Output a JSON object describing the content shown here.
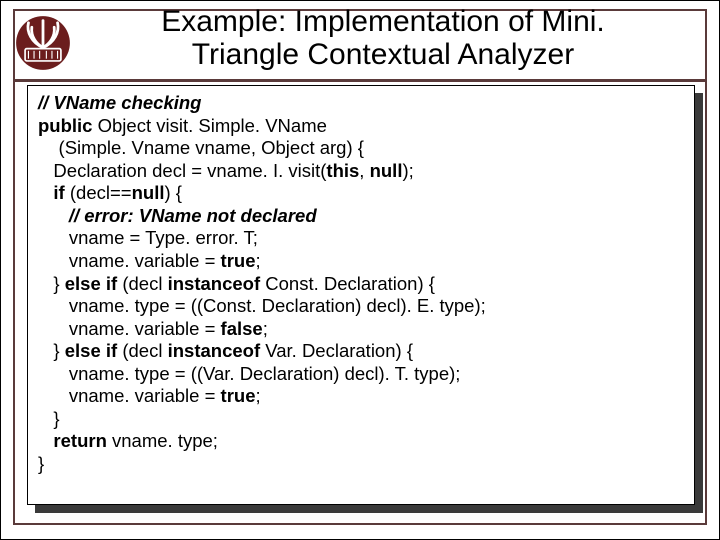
{
  "title_line1": "Example: Implementation of Mini.",
  "title_line2": "Triangle Contextual Analyzer",
  "code": {
    "c00a": "// VName checking",
    "c01a": "public",
    "c01b": " Object visit. Simple. VName",
    "c02a": "    (Simple. Vname vname, Object arg) {",
    "c03a": "   Declaration decl = vname. I. visit(",
    "c03b": "this",
    "c03c": ", ",
    "c03d": "null",
    "c03e": ");",
    "c04a": "   ",
    "c04b": "if",
    "c04c": " (decl==",
    "c04d": "null",
    "c04e": ") {",
    "c05a": "      ",
    "c05b": "// error: VName not declared",
    "c06a": "      vname = Type. error. T;",
    "c07a": "      vname. variable = ",
    "c07b": "true",
    "c07c": ";",
    "c08a": "   } ",
    "c08b": "else if",
    "c08c": " (decl ",
    "c08d": "instanceof",
    "c08e": " Const. Declaration) {",
    "c09a": "      vname. type = ((Const. Declaration) decl). E. type);",
    "c10a": "      vname. variable = ",
    "c10b": "false",
    "c10c": ";",
    "c11a": "   } ",
    "c11b": "else if",
    "c11c": " (decl ",
    "c11d": "instanceof",
    "c11e": " Var. Declaration) {",
    "c12a": "      vname. type = ((Var. Declaration) decl). T. type);",
    "c13a": "      vname. variable = ",
    "c13b": "true",
    "c13c": ";",
    "c14a": "   }",
    "c15a": "   ",
    "c15b": "return",
    "c15c": " vname. type;",
    "c16a": "}"
  }
}
